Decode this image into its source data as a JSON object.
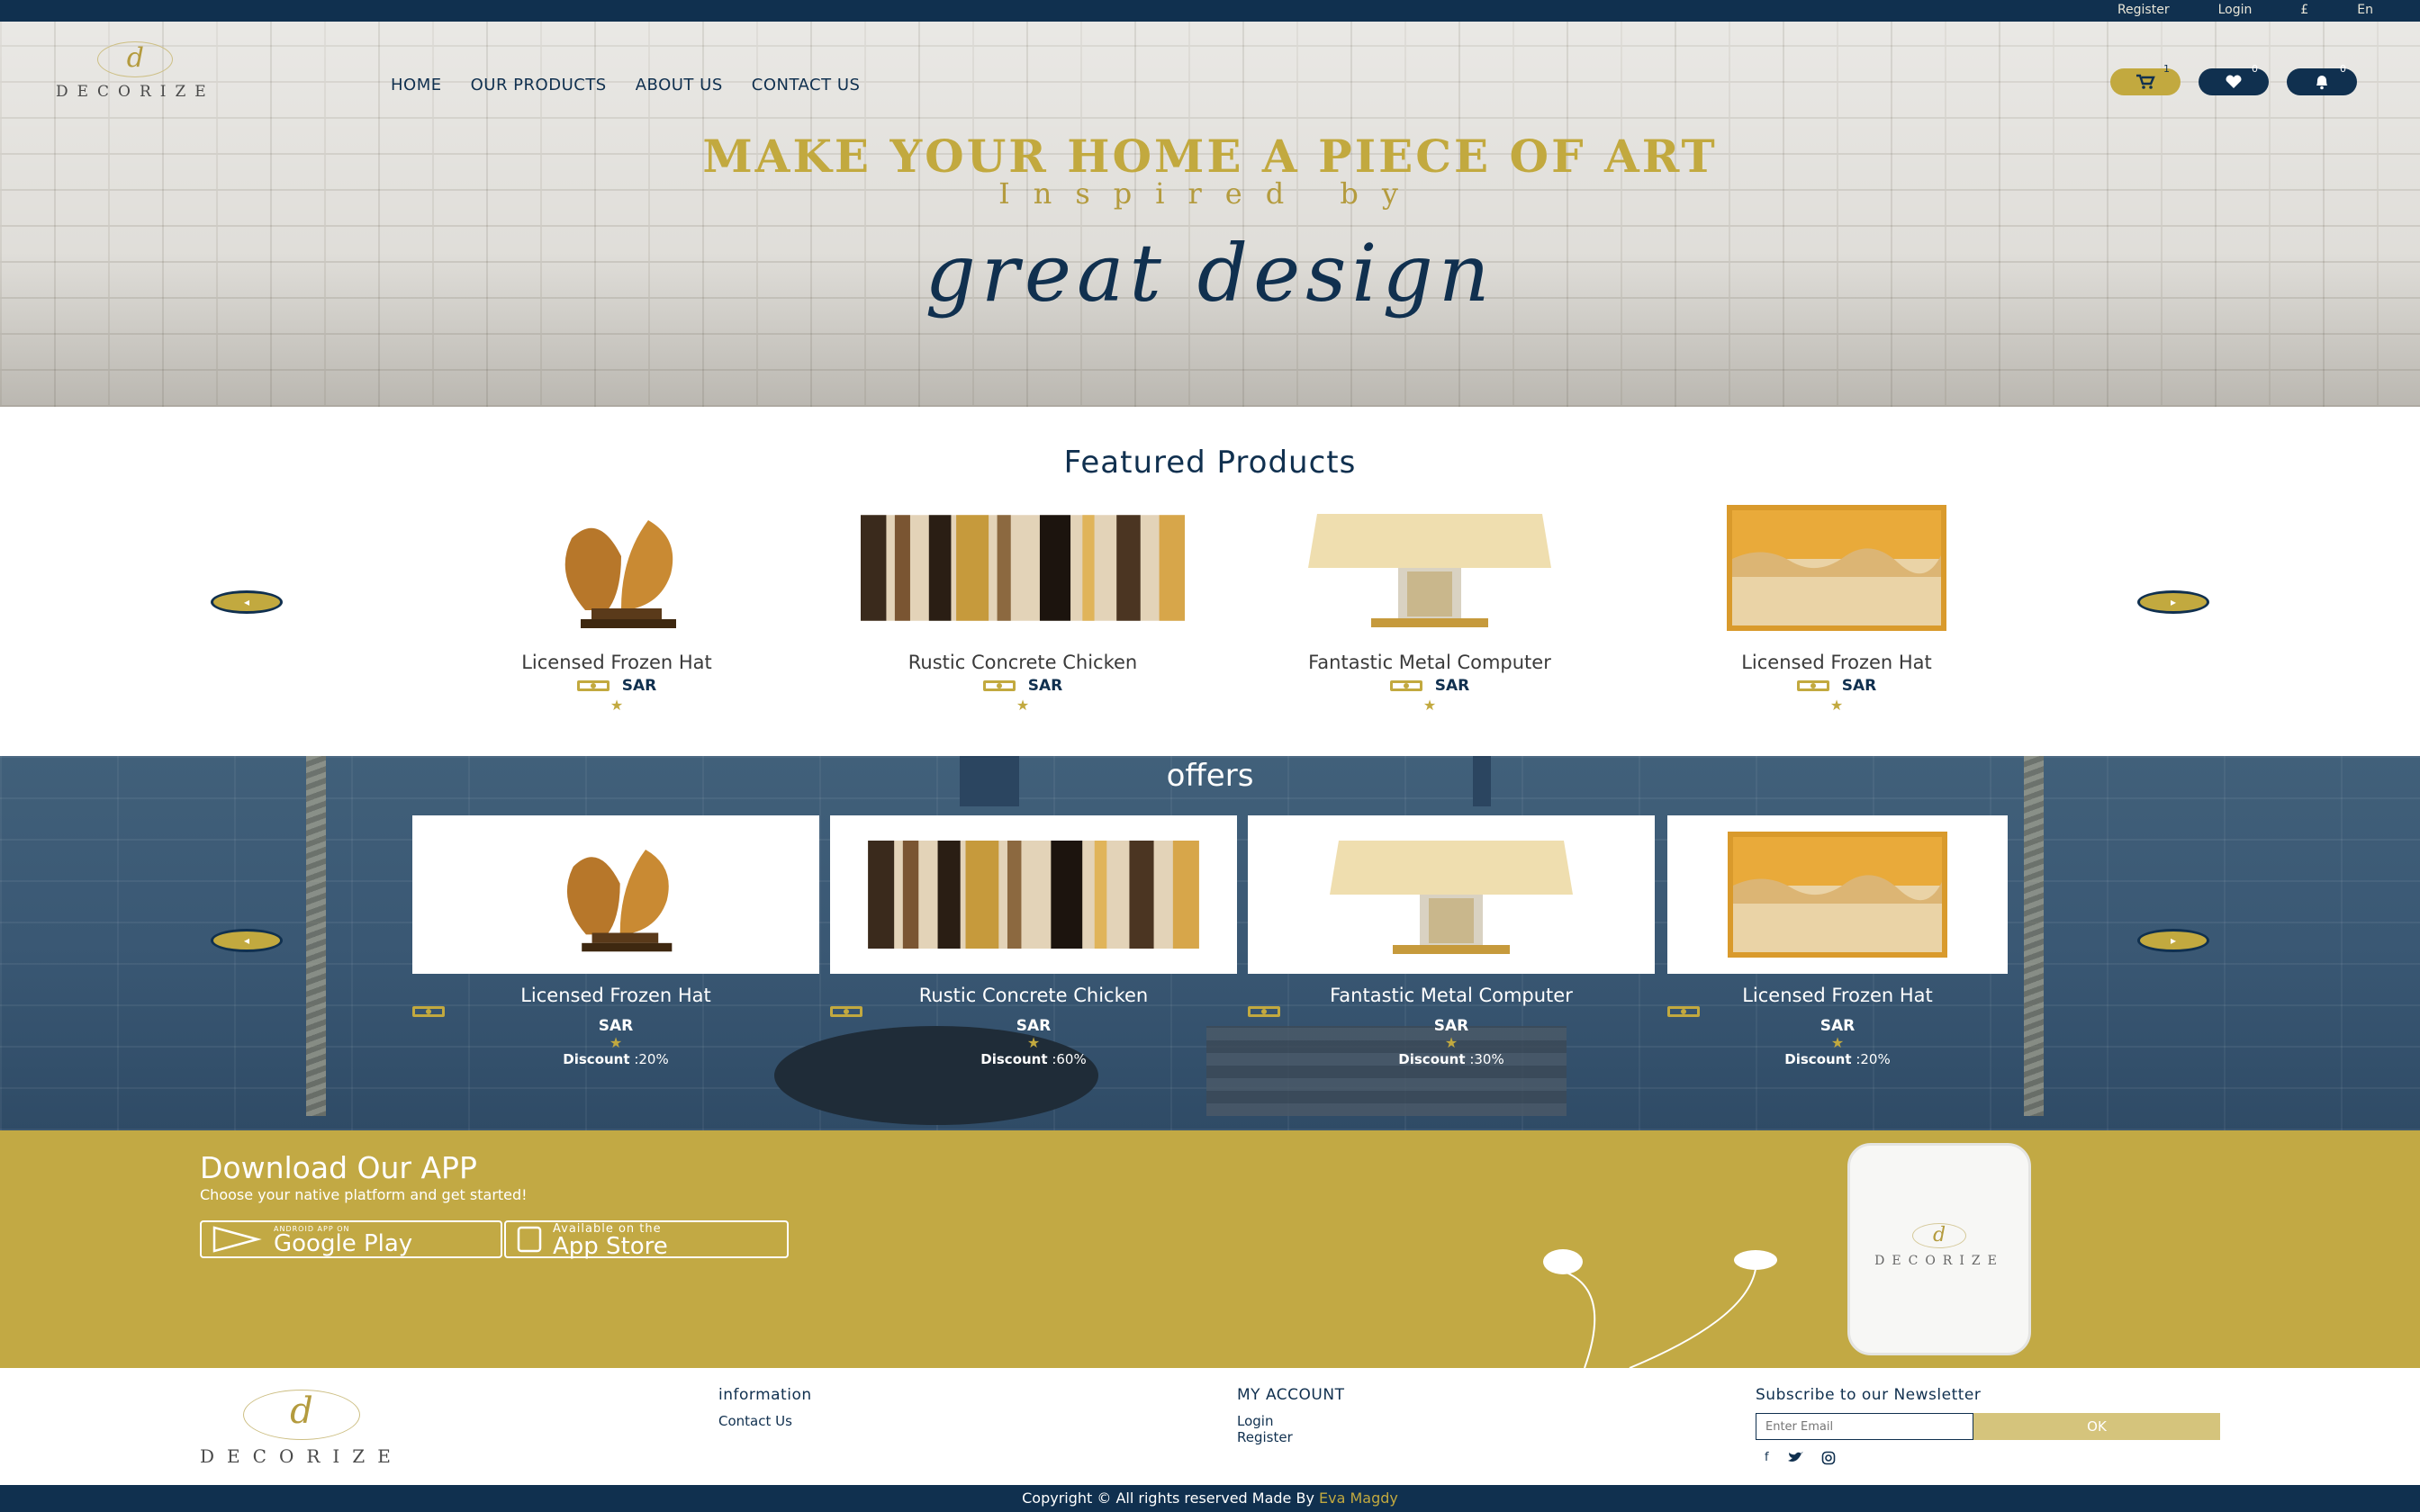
{
  "topbar": {
    "links": [
      "Register",
      "Login",
      "£",
      "En"
    ]
  },
  "brand": {
    "monogram": "d",
    "name": "DECORIZE"
  },
  "nav": {
    "items": [
      "HOME",
      "OUR PRODUCTS",
      "ABOUT US",
      "CONTACT US"
    ]
  },
  "header_icons": [
    {
      "name": "cart-icon",
      "count": "1"
    },
    {
      "name": "heart-icon",
      "count": "0"
    },
    {
      "name": "bell-icon",
      "count": "0"
    }
  ],
  "hero": {
    "title": "MAKE YOUR HOME A PIECE OF ART",
    "subtitle": "Inspired by",
    "script": "great design"
  },
  "featured": {
    "title": "Featured Products",
    "products": [
      {
        "name": "Licensed Frozen Hat",
        "currency": "SAR",
        "image": "sculpture"
      },
      {
        "name": "Rustic Concrete Chicken",
        "currency": "SAR",
        "image": "abstract-painting"
      },
      {
        "name": "Fantastic Metal Computer",
        "currency": "SAR",
        "image": "table-lamp"
      },
      {
        "name": "Licensed Frozen Hat",
        "currency": "SAR",
        "image": "amber-art"
      }
    ]
  },
  "offers": {
    "title": "offers",
    "products": [
      {
        "name": "Licensed Frozen Hat",
        "currency": "SAR",
        "discount_label": "Discount",
        "discount": ":20%",
        "image": "sculpture"
      },
      {
        "name": "Rustic Concrete Chicken",
        "currency": "SAR",
        "discount_label": "Discount",
        "discount": ":60%",
        "image": "abstract-painting"
      },
      {
        "name": "Fantastic Metal Computer",
        "currency": "SAR",
        "discount_label": "Discount",
        "discount": ":30%",
        "image": "table-lamp"
      },
      {
        "name": "Licensed Frozen Hat",
        "currency": "SAR",
        "discount_label": "Discount",
        "discount": ":20%",
        "image": "amber-art"
      }
    ]
  },
  "app": {
    "title": "Download Our APP",
    "subtitle": "Choose your native platform and get started!",
    "google_small": "ANDROID APP ON",
    "google_big": "Google Play",
    "apple_small": "Available on the",
    "apple_big": "App Store"
  },
  "footer": {
    "info_title": "information",
    "info_links": [
      "Contact Us"
    ],
    "account_title": "MY ACCOUNT",
    "account_links": [
      "Login",
      "Register"
    ],
    "newsletter_title": "Subscribe to our Newsletter",
    "newsletter_placeholder": "Enter Email",
    "newsletter_button": "OK",
    "copyright": "Copyright © All rights reserved Made By",
    "author": "Eva Magdy"
  },
  "colors": {
    "navy": "#10304f",
    "gold": "#c2a93f"
  }
}
